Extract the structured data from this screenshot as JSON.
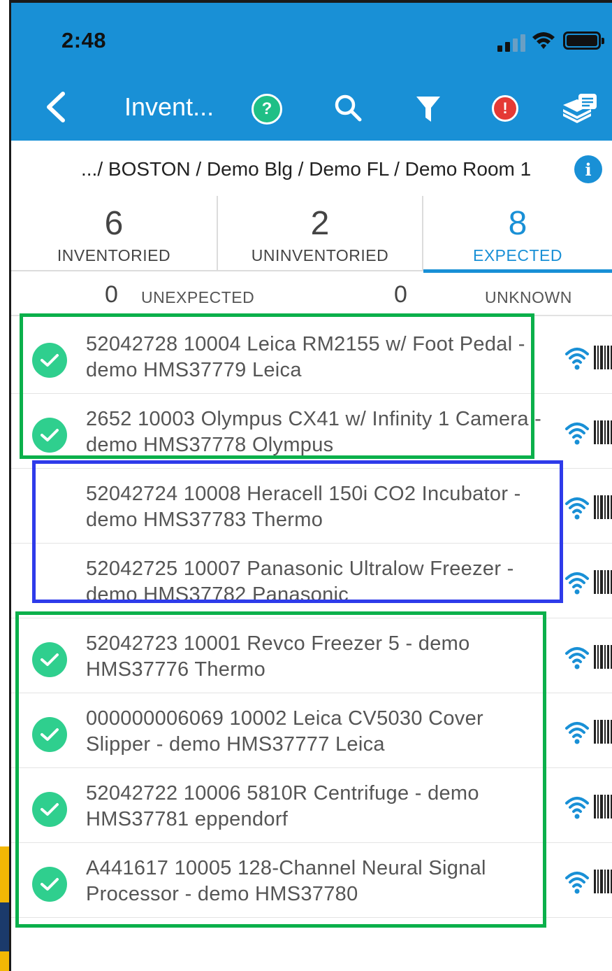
{
  "status_bar": {
    "time": "2:48"
  },
  "nav": {
    "title": "Invent...",
    "help_glyph": "?",
    "alert_glyph": "!"
  },
  "breadcrumb": {
    "text": ".../ BOSTON / Demo Blg / Demo FL / Demo Room 1",
    "info_glyph": "i"
  },
  "tabs": [
    {
      "count": "6",
      "label": "INVENTORIED",
      "active": false
    },
    {
      "count": "2",
      "label": "UNINVENTORIED",
      "active": false
    },
    {
      "count": "8",
      "label": "EXPECTED",
      "active": true
    }
  ],
  "sub_stats": {
    "unexpected_count": "0",
    "unexpected_label": "UNEXPECTED",
    "unknown_count": "0",
    "unknown_label": "UNKNOWN"
  },
  "items": [
    {
      "text": "52042728 10004 Leica RM2155 w/ Foot Pedal - demo HMS37779 Leica",
      "inventoried": true
    },
    {
      "text": "2652 10003 Olympus CX41 w/ Infinity 1 Camera - demo HMS37778 Olympus",
      "inventoried": true
    },
    {
      "text": "52042724 10008 Heracell 150i CO2 Incubator - demo HMS37783 Thermo",
      "inventoried": false
    },
    {
      "text": "52042725 10007 Panasonic Ultralow Freezer - demo HMS37782 Panasonic",
      "inventoried": false
    },
    {
      "text": "52042723 10001 Revco Freezer 5 - demo HMS37776 Thermo",
      "inventoried": true
    },
    {
      "text": "000000006069 10002 Leica CV5030 Cover Slipper - demo HMS37777 Leica",
      "inventoried": true
    },
    {
      "text": "52042722 10006 5810R Centrifuge - demo HMS37781 eppendorf",
      "inventoried": true
    },
    {
      "text": "A441617 10005 128-Channel Neural Signal Processor - demo HMS37780",
      "inventoried": true
    }
  ],
  "colors": {
    "header": "#1990d6",
    "check": "#2fcf8e",
    "box_green": "#0bb04b",
    "box_blue": "#2e3bea"
  },
  "icons": [
    "back-icon",
    "help-icon",
    "search-icon",
    "filter-icon",
    "alert-icon",
    "stack-icon",
    "info-icon",
    "rfid-icon",
    "barcode-icon",
    "check-icon"
  ]
}
